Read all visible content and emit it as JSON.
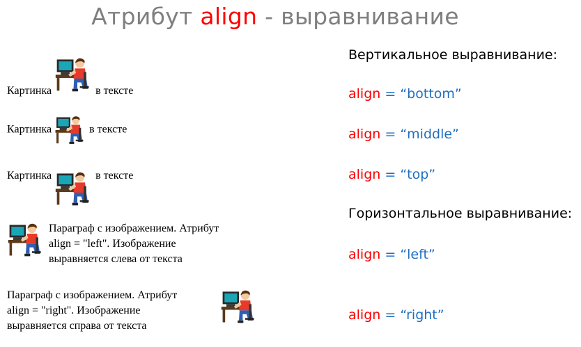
{
  "title": {
    "prefix": "Атрибут ",
    "accent": "align",
    "suffix": " - выравнивание"
  },
  "examples": [
    {
      "before": "Картинка",
      "after": "в тексте"
    },
    {
      "before": "Картинка",
      "after": "в тексте"
    },
    {
      "before": "Картинка",
      "after": "в тексте"
    }
  ],
  "para_left": {
    "lines": [
      "Параграф с изображением. Атрибут",
      "align = \"left\". Изображение",
      "выравняется слева от текста"
    ]
  },
  "para_right": {
    "lines": [
      "Параграф с изображением. Атрибут",
      "align = \"right\". Изображение",
      "выравняется справа от текста"
    ]
  },
  "right_column": {
    "vertical_heading": "Вертикальное выравнивание:",
    "horizontal_heading": "Горизонтальное выравнивание:",
    "attr_name": "align",
    "equals": " = ",
    "values": [
      "“bottom”",
      "“middle”",
      "“top”",
      "“left”",
      "“right”"
    ]
  },
  "icon": "person-at-computer-icon",
  "colors": {
    "title": "#7f7f7f",
    "accent": "#ff0000",
    "value": "#1f6fc0"
  }
}
